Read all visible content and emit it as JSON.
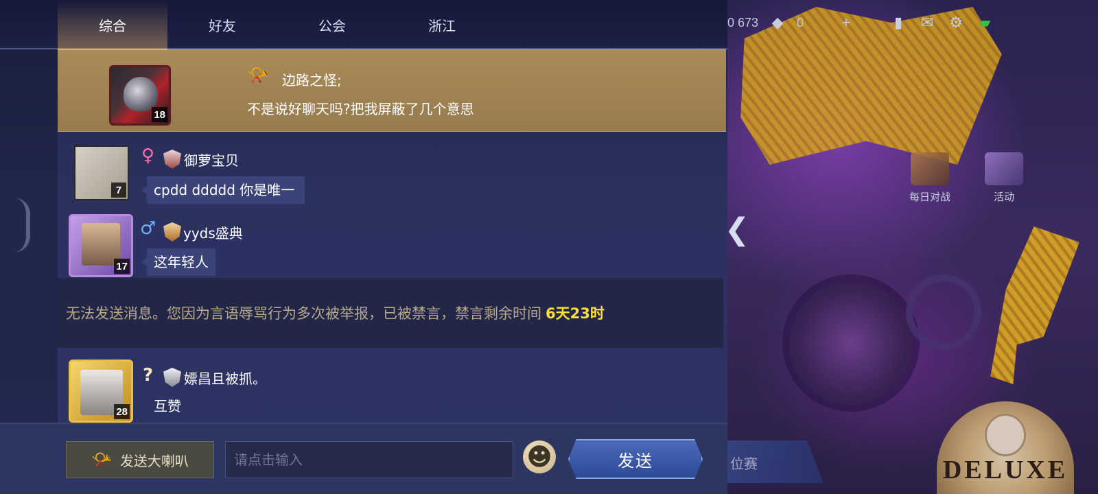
{
  "top_hud": {
    "currency_value": "0 673",
    "ticket_value": "0"
  },
  "tabs": [
    {
      "label": "综合",
      "active": true
    },
    {
      "label": "好友",
      "active": false
    },
    {
      "label": "公会",
      "active": false
    },
    {
      "label": "浙江",
      "active": false
    }
  ],
  "broadcast": {
    "level": "18",
    "name": "边路之怪;",
    "text": "不是说好聊天吗?把我屏蔽了几个意思"
  },
  "messages": [
    {
      "gender": "♀",
      "gender_color": "#ff6ea8",
      "level": "7",
      "name": "御萝宝贝",
      "text": "cpdd ddddd 你是唯一"
    },
    {
      "gender": "♂",
      "gender_color": "#6ab0ff",
      "level": "17",
      "name": "yyds盛典",
      "text": "这年轻人"
    },
    {
      "gender": "?",
      "gender_color": "#f1e3c4",
      "level": "28",
      "name": "嫖昌且被抓。",
      "text": "互赞"
    }
  ],
  "notice": {
    "text": "无法发送消息。您因为言语辱骂行为多次被举报，已被禁言，禁言剩余时间",
    "remaining": "6天23时"
  },
  "background": {
    "daily_battle_label": "每日对战",
    "event_label": "活动",
    "ranked_label": "位赛",
    "deluxe_label": "DELUXE"
  },
  "input_bar": {
    "horn_button_label": "发送大喇叭",
    "input_placeholder": "请点击输入",
    "input_value": "",
    "send_button_label": "发送"
  },
  "colors": {
    "accent_gold": "#e4c27d",
    "notice_highlight": "#ffe135",
    "send_blue": "#2d4a96"
  }
}
